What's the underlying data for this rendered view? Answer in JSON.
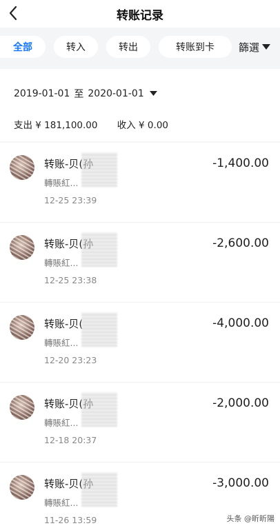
{
  "header": {
    "title": "转账记录"
  },
  "tabs": {
    "all": "全部",
    "transfer_in": "转入",
    "transfer_out": "转出",
    "to_card": "转账到卡",
    "filter": "篩選"
  },
  "summary": {
    "date_start": "2019-01-01",
    "date_separator": "至",
    "date_end": "2020-01-01",
    "expense": "支出 ¥ 181,100.00",
    "income": "收入 ¥ 0.00"
  },
  "transactions": [
    {
      "name": "转账-贝(孙",
      "note": "轉賬紅...",
      "time": "12-25 23:39",
      "amount": "-1,400.00"
    },
    {
      "name": "转账-贝(孙",
      "note": "轉賬紅...",
      "time": "12-25 23:38",
      "amount": "-2,600.00"
    },
    {
      "name": "转账-贝(",
      "note": "轉賬紅...",
      "time": "12-20 23:23",
      "amount": "-4,000.00"
    },
    {
      "name": "转账-贝(孙",
      "note": "轉賬紅...",
      "time": "12-18 20:37",
      "amount": "-2,000.00"
    },
    {
      "name": "转账-贝(孙",
      "note": "轉賬紅...",
      "time": "11-26 13:59",
      "amount": "-3,000.00"
    }
  ],
  "watermark": "头条 @昕昕陽",
  "colors": {
    "accent": "#1677ff",
    "background": "#f4f5f7"
  }
}
